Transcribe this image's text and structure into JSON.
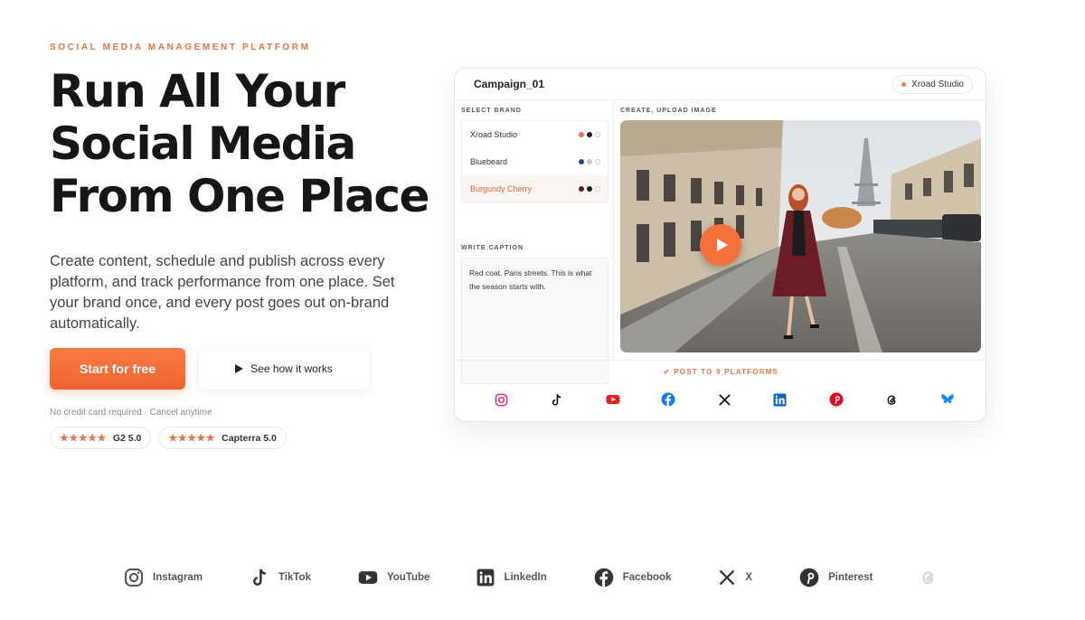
{
  "hero": {
    "eyebrow": "SOCIAL MEDIA MANAGEMENT PLATFORM",
    "headline_lines": [
      "Run All Your",
      "Social Media",
      "From One Place"
    ],
    "subtext": "Create content, schedule and publish across every platform, and track performance from one place. Set your brand once, and every post goes out on-brand automatically.",
    "cta_primary": "Start for free",
    "cta_secondary": "See how it works",
    "note": "No credit card required · Cancel anytime",
    "ratings": [
      {
        "stars": "★★★★★",
        "label": "G2 5.0"
      },
      {
        "stars": "★★★★★",
        "label": "Capterra 5.0"
      }
    ]
  },
  "mock": {
    "title": "Campaign_01",
    "studio_pill": "Xroad Studio",
    "select_brand_label": "SELECT BRAND",
    "brands": [
      {
        "name": "Xroad Studio",
        "colors": [
          "#e8744a",
          "#222222"
        ],
        "active": false
      },
      {
        "name": "Bluebeard",
        "colors": [
          "#2d4a8a",
          "#c8c8c8"
        ],
        "active": false
      },
      {
        "name": "Burgundy Cherry",
        "colors": [
          "#6b1a22",
          "#1a1a1a"
        ],
        "active": true
      }
    ],
    "write_caption_label": "WRITE CAPTION",
    "caption": "Red coat. Paris streets. This is what the season starts with.",
    "upload_label": "CREATE, UPLOAD IMAGE",
    "post_label": "POST TO 9 PLATFORMS",
    "platform_icons": [
      "instagram-icon",
      "tiktok-icon",
      "youtube-icon",
      "facebook-icon",
      "x-icon",
      "linkedin-icon",
      "pinterest-icon",
      "threads-icon",
      "bluesky-icon"
    ]
  },
  "strip": {
    "items": [
      "Instagram",
      "TikTok",
      "YouTube",
      "LinkedIn",
      "Facebook",
      "X",
      "Pinterest"
    ]
  },
  "colors": {
    "accent": "#f0642d",
    "text": "#161616"
  }
}
